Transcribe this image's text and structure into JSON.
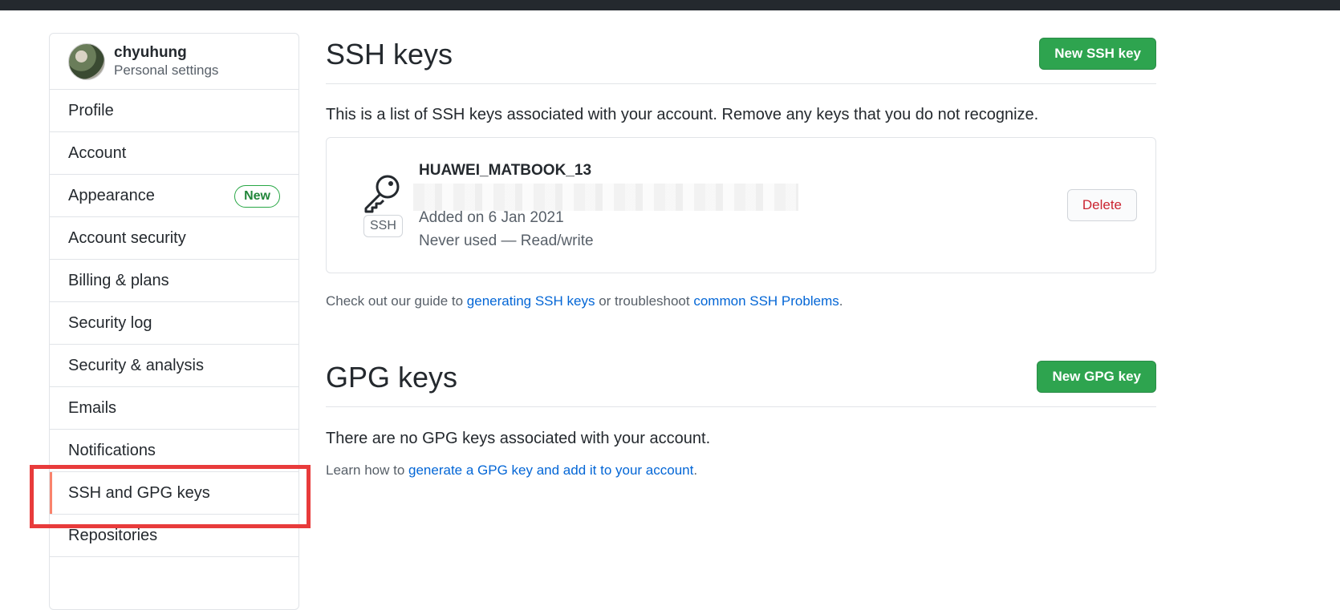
{
  "sidebar": {
    "username": "chyuhung",
    "subtitle": "Personal settings",
    "items": [
      {
        "label": "Profile"
      },
      {
        "label": "Account"
      },
      {
        "label": "Appearance",
        "badge": "New"
      },
      {
        "label": "Account security"
      },
      {
        "label": "Billing & plans"
      },
      {
        "label": "Security log"
      },
      {
        "label": "Security & analysis"
      },
      {
        "label": "Emails"
      },
      {
        "label": "Notifications"
      },
      {
        "label": "SSH and GPG keys",
        "selected": true
      },
      {
        "label": "Repositories"
      }
    ]
  },
  "ssh": {
    "title": "SSH keys",
    "new_button": "New SSH key",
    "description": "This is a list of SSH keys associated with your account. Remove any keys that you do not recognize.",
    "key": {
      "name": "HUAWEI_MATBOOK_13",
      "type_label": "SSH",
      "added": "Added on 6 Jan 2021",
      "usage": "Never used — Read/write",
      "delete_label": "Delete"
    },
    "guide_prefix": "Check out our guide to ",
    "guide_link1": "generating SSH keys",
    "guide_middle": " or troubleshoot ",
    "guide_link2": "common SSH Problems",
    "guide_suffix": "."
  },
  "gpg": {
    "title": "GPG keys",
    "new_button": "New GPG key",
    "empty_text": "There are no GPG keys associated with your account.",
    "learn_prefix": "Learn how to ",
    "learn_link": "generate a GPG key and add it to your account",
    "learn_suffix": "."
  },
  "colors": {
    "accent_green": "#2ea44f",
    "selected_indicator": "#f9826c",
    "highlight_box": "#e83b3b",
    "link": "#0366d6",
    "danger": "#cb2431"
  }
}
